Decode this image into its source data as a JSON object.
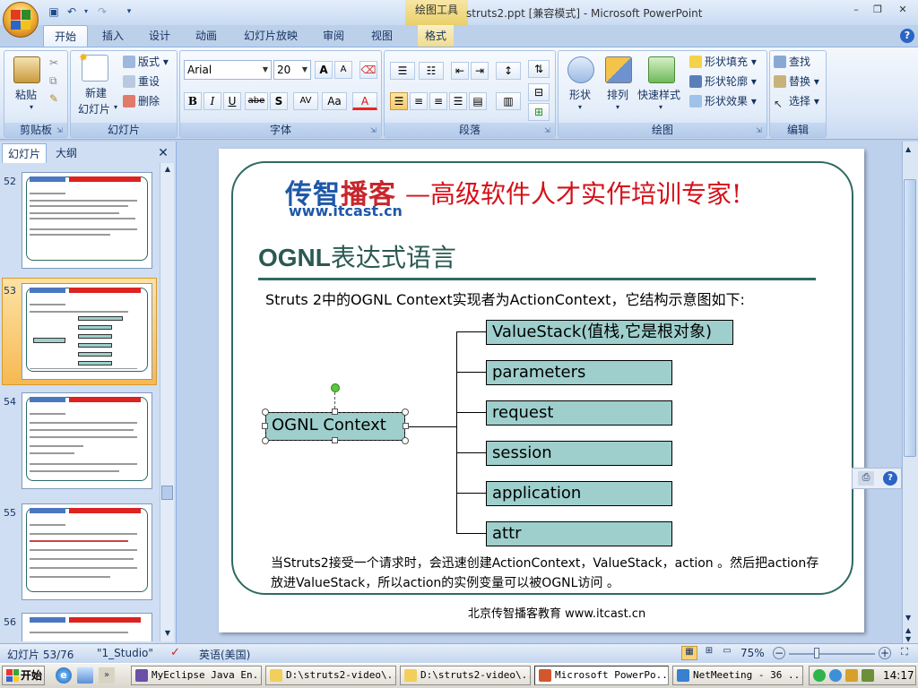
{
  "window": {
    "title": "struts2.ppt [兼容模式] - Microsoft PowerPoint",
    "context_tool": "绘图工具",
    "controls": {
      "minimize": "–",
      "restore": "❐",
      "close": "✕"
    }
  },
  "ribbon_tabs": [
    "开始",
    "插入",
    "设计",
    "动画",
    "幻灯片放映",
    "审阅",
    "视图",
    "格式"
  ],
  "ribbon": {
    "clipboard": {
      "label": "剪贴板",
      "paste": "粘贴"
    },
    "slides": {
      "label": "幻灯片",
      "new_slide_1": "新建",
      "new_slide_2": "幻灯片",
      "layout": "版式",
      "reset": "重设",
      "delete": "删除"
    },
    "font": {
      "label": "字体",
      "family": "Arial",
      "size": "20",
      "bold": "B",
      "italic": "I",
      "underline": "U",
      "strike": "abe",
      "shadow": "S",
      "spacing": "AV",
      "case": "Aa",
      "color": "A",
      "grow": "A",
      "shrink": "A"
    },
    "paragraph": {
      "label": "段落"
    },
    "drawing": {
      "label": "绘图",
      "shapes": "形状",
      "arrange": "排列",
      "quick_styles": "快速样式",
      "fill": "形状填充",
      "outline": "形状轮廓",
      "effects": "形状效果"
    },
    "editing": {
      "label": "编辑",
      "find": "查找",
      "replace": "替换",
      "select": "选择"
    }
  },
  "left_pane": {
    "tabs": [
      "幻灯片",
      "大纲"
    ],
    "close": "✕",
    "thumbnails": [
      {
        "num": "52",
        "title": "OGNL表达式语言"
      },
      {
        "num": "53",
        "title": "OGNL表达式语言",
        "selected": true
      },
      {
        "num": "54",
        "title": "OGNL表达式语言"
      },
      {
        "num": "55",
        "title": "OGNL表达式语言"
      },
      {
        "num": "56",
        "title": ""
      }
    ]
  },
  "slide": {
    "brand": {
      "part1": "传智",
      "part2": "播客",
      "url": "www.itcast.cn",
      "slogan": "—高级软件人才实作培训专家!"
    },
    "title_en": "OGNL",
    "title_cn": "表达式语言",
    "intro": "Struts 2中的OGNL Context实现者为ActionContext，它结构示意图如下:",
    "root_box": "OGNL Context",
    "children": [
      "ValueStack(值栈,它是根对象)",
      "parameters",
      "request",
      "session",
      "application",
      "attr"
    ],
    "footnote": "当Struts2接受一个请求时，会迅速创建ActionContext，ValueStack，action 。然后把action存放进ValueStack，所以action的实例变量可以被OGNL访问 。",
    "footer": "北京传智播客教育 www.itcast.cn"
  },
  "status": {
    "slide_info": "幻灯片 53/76",
    "theme": "\"1_Studio\"",
    "language": "英语(美国)",
    "zoom": "75%"
  },
  "taskbar": {
    "start": "开始",
    "tasks": [
      "MyEclipse Java En...",
      "D:\\struts2-video\\...",
      "D:\\struts2-video\\...",
      "Microsoft PowerPo...",
      "NetMeeting - 36 ..."
    ],
    "clock": "14:17"
  },
  "colors": {
    "accent": "#2f6a62",
    "box_fill": "#9ecfcc",
    "slogan": "#d4111a",
    "brand_blue": "#1f58a8",
    "brand_red": "#c8262c"
  }
}
